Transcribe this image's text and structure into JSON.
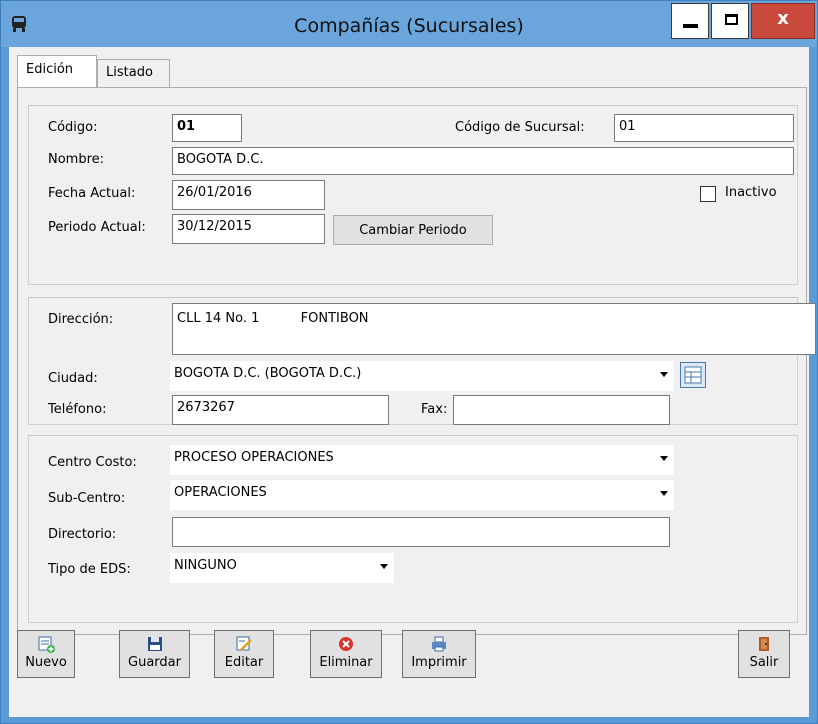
{
  "window": {
    "title": "Compañías (Sucursales)",
    "close_glyph": "x"
  },
  "tabs": [
    {
      "label": "Edición",
      "active": true
    },
    {
      "label": "Listado",
      "active": false
    }
  ],
  "group1": {
    "codigo_label": "Código:",
    "codigo_value": "01",
    "codigo_sucursal_label": "Código de Sucursal:",
    "codigo_sucursal_value": "01",
    "nombre_label": "Nombre:",
    "nombre_value": "BOGOTA D.C.",
    "fecha_actual_label": "Fecha Actual:",
    "fecha_actual_value": "26/01/2016",
    "inactivo_label": "Inactivo",
    "inactivo_checked": false,
    "periodo_actual_label": "Periodo Actual:",
    "periodo_actual_value": "30/12/2015",
    "cambiar_periodo_label": "Cambiar Periodo"
  },
  "group2": {
    "direccion_label": "Dirección:",
    "direccion_value": "CLL 14 No. 1          FONTIBON",
    "ciudad_label": "Ciudad:",
    "ciudad_value": "BOGOTA D.C. (BOGOTA D.C.)",
    "telefono_label": "Teléfono:",
    "telefono_value": "2673267",
    "fax_label": "Fax:",
    "fax_value": ""
  },
  "group3": {
    "centro_costo_label": "Centro Costo:",
    "centro_costo_value": "PROCESO OPERACIONES",
    "sub_centro_label": "Sub-Centro:",
    "sub_centro_value": "OPERACIONES",
    "directorio_label": "Directorio:",
    "directorio_value": "",
    "tipo_eds_label": "Tipo de EDS:",
    "tipo_eds_value": "NINGUNO"
  },
  "toolbar": {
    "nuevo": "Nuevo",
    "guardar": "Guardar",
    "editar": "Editar",
    "eliminar": "Eliminar",
    "imprimir": "Imprimir",
    "salir": "Salir"
  },
  "colors": {
    "title_bar": "#6aa6dc",
    "close_button": "#c94a3d",
    "panel": "#f0f0f0"
  }
}
